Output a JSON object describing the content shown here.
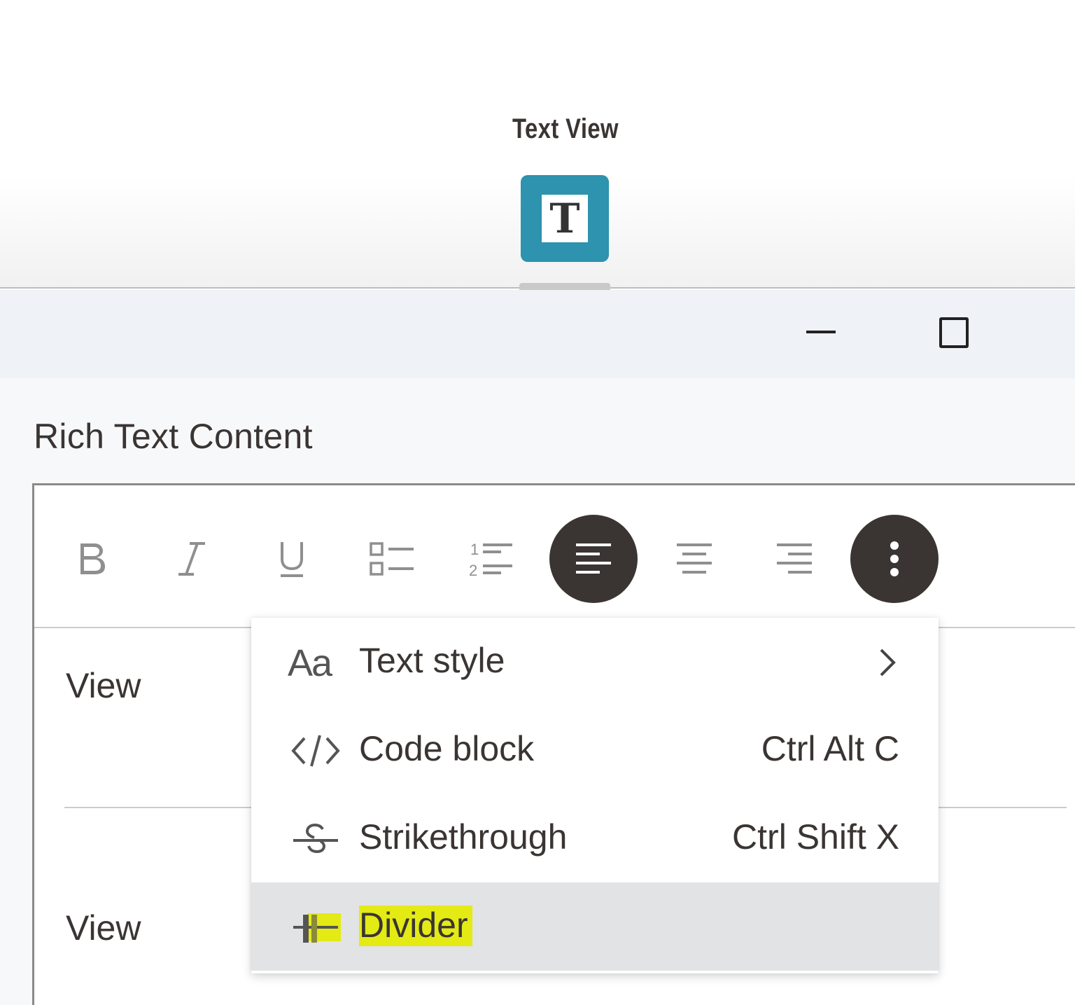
{
  "widget": {
    "title": "Text View",
    "icon": "text-t-icon",
    "icon_letter": "T",
    "accent_color": "#2d93ae"
  },
  "window": {
    "minimize_icon": "minimize-icon",
    "maximize_icon": "maximize-icon",
    "background": "#eff2f6"
  },
  "field": {
    "label": "Rich Text Content"
  },
  "toolbar": {
    "buttons": [
      {
        "name": "bold",
        "icon": "bold-icon",
        "active": false
      },
      {
        "name": "italic",
        "icon": "italic-icon",
        "active": false
      },
      {
        "name": "underline",
        "icon": "underline-icon",
        "active": false
      },
      {
        "name": "bulleted-list",
        "icon": "bulleted-list-icon",
        "active": false
      },
      {
        "name": "numbered-list",
        "icon": "numbered-list-icon",
        "active": false
      },
      {
        "name": "align-left",
        "icon": "align-left-icon",
        "active": true
      },
      {
        "name": "align-center",
        "icon": "align-center-icon",
        "active": false
      },
      {
        "name": "align-right",
        "icon": "align-right-icon",
        "active": false
      },
      {
        "name": "more",
        "icon": "more-vertical-icon",
        "active": true
      }
    ],
    "active_color": "#3a3533"
  },
  "editor_rows": [
    {
      "text": "View"
    },
    {
      "text": "View"
    }
  ],
  "menu": {
    "items": [
      {
        "icon": "text-style-icon",
        "icon_text": "Aa",
        "label": "Text style",
        "shortcut": "",
        "submenu": true
      },
      {
        "icon": "code-block-icon",
        "label": "Code block",
        "shortcut": "Ctrl Alt C",
        "submenu": false
      },
      {
        "icon": "strikethrough-icon",
        "label": "Strikethrough",
        "shortcut": "Ctrl Shift X",
        "submenu": false
      },
      {
        "icon": "divider-icon",
        "label": "Divider",
        "shortcut": "",
        "submenu": false,
        "hovered": true,
        "highlighted": true
      }
    ],
    "hover_color": "#e2e3e4",
    "highlight_color": "#e4ea14"
  }
}
